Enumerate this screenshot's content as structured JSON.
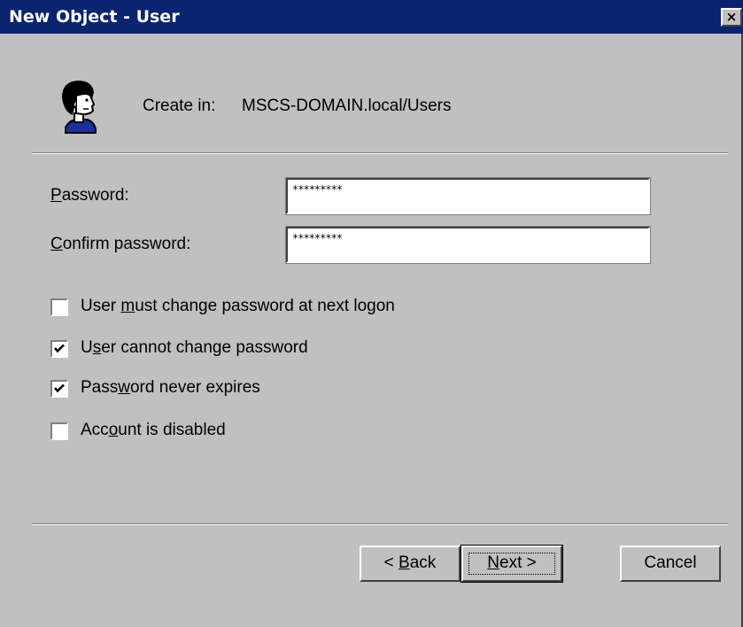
{
  "window": {
    "title": "New Object - User",
    "close_glyph": "×"
  },
  "header": {
    "create_in_label": "Create in:",
    "create_in_path": "MSCS-DOMAIN.local/Users",
    "icon": "user-icon"
  },
  "form": {
    "password": {
      "label_prefix": "",
      "label_accel": "P",
      "label_rest": "assword:",
      "value": "*********"
    },
    "confirm_password": {
      "label_prefix": "",
      "label_accel": "C",
      "label_rest": "onfirm password:",
      "value": "*********"
    }
  },
  "options": [
    {
      "prefix": "User ",
      "accel": "m",
      "rest": "ust change password at next logon",
      "checked": false
    },
    {
      "prefix": "U",
      "accel": "s",
      "rest": "er cannot change password",
      "checked": true
    },
    {
      "prefix": "Pass",
      "accel": "w",
      "rest": "ord never expires",
      "checked": true
    },
    {
      "prefix": "Acc",
      "accel": "o",
      "rest": "unt is disabled",
      "checked": false
    }
  ],
  "buttons": {
    "back": {
      "prefix": "< ",
      "accel": "B",
      "rest": "ack"
    },
    "next": {
      "prefix": "",
      "accel": "N",
      "rest": "ext >"
    },
    "cancel": {
      "label": "Cancel"
    }
  }
}
